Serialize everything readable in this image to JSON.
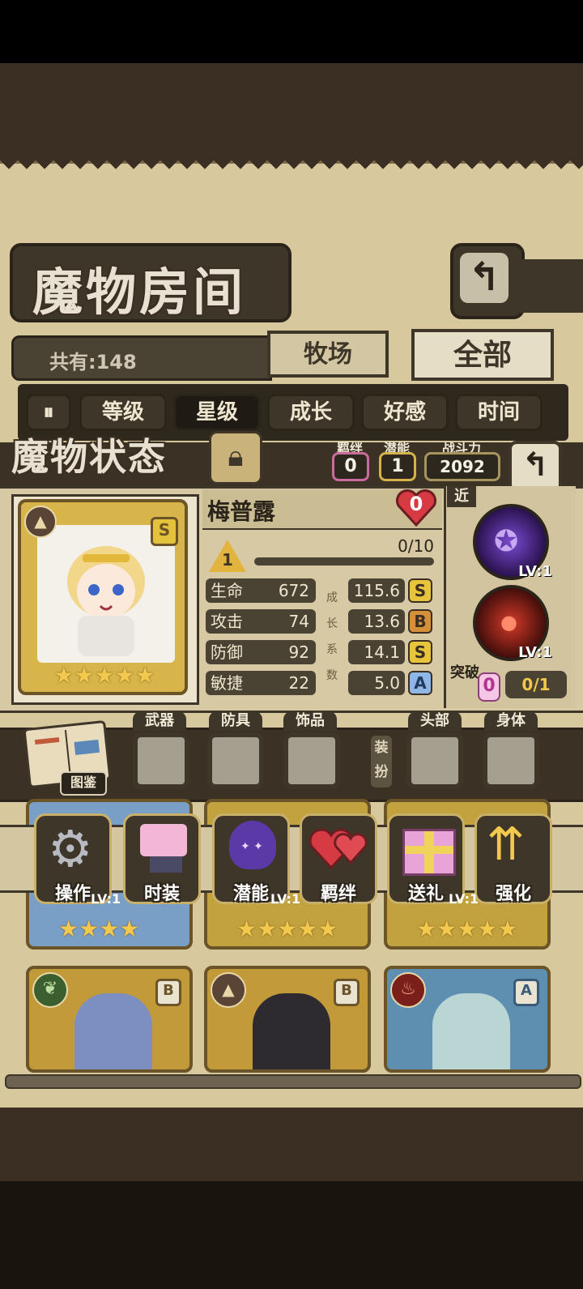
{
  "colors": {
    "parchment": "#d7c89e",
    "plate": "#4a4232",
    "gold": "#d4b24c",
    "red": "#d63a43"
  },
  "header": {
    "room_title": "魔物房间",
    "total_label": "共有:148",
    "filters": {
      "ranch": "牧场",
      "all": "全部"
    },
    "sort_tabs": [
      "等级",
      "星级",
      "成长",
      "好感",
      "时间"
    ],
    "selected_sort": "星级"
  },
  "status_panel": {
    "title": "魔物状态",
    "bond_label": "羁绊",
    "bond_value": "0",
    "potential_label": "潜能",
    "potential_value": "1",
    "power_label": "战斗力",
    "power_value": "2092",
    "monster_name": "梅普露",
    "hearts": "0",
    "grade": "S",
    "level_badge": "1",
    "exp_text": "0/10",
    "growth_label": "成长系数",
    "stats": [
      {
        "name": "生命",
        "value": "672",
        "growth": "115.6",
        "rank": "S"
      },
      {
        "name": "攻击",
        "value": "74",
        "growth": "13.6",
        "rank": "B"
      },
      {
        "name": "防御",
        "value": "92",
        "growth": "14.1",
        "rank": "S"
      },
      {
        "name": "敏捷",
        "value": "22",
        "growth": "5.0",
        "rank": "A"
      }
    ],
    "range_tag": "近",
    "skills": [
      {
        "level": "LV:1"
      },
      {
        "level": "LV:1"
      }
    ],
    "breakthrough_label": "突破",
    "breakthrough_count": "0",
    "breakthrough_progress": "0/1",
    "stars": 5
  },
  "equipment": {
    "codex_label": "图鉴",
    "slots": {
      "weapon": "武器",
      "armor": "防具",
      "accessory": "饰品",
      "dress_label": "装扮",
      "head": "头部",
      "body": "身体"
    }
  },
  "actions": [
    "操作",
    "时装",
    "潜能",
    "羁绊",
    "送礼",
    "强化"
  ],
  "background_cards": [
    {
      "grade": "B",
      "level": "LV:1"
    },
    {
      "grade": "B",
      "level": "LV:1"
    },
    {
      "grade": "A",
      "level": "LV:1"
    }
  ]
}
